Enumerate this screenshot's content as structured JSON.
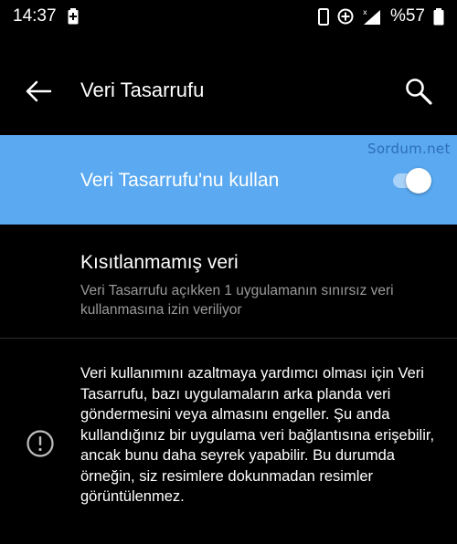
{
  "status_bar": {
    "time": "14:37",
    "battery_percent": "%57",
    "icons": [
      "battery-saver-icon",
      "phone-icon",
      "data-saver-icon",
      "signal-icon",
      "battery-icon"
    ]
  },
  "app_bar": {
    "title": "Veri Tasarrufu",
    "back_icon": "arrow-left-icon",
    "search_icon": "search-icon"
  },
  "master_switch": {
    "label": "Veri Tasarrufu'nu kullan",
    "state": "on",
    "accent_color": "#5aa9f1"
  },
  "watermark": "Sordum.net",
  "unrestricted": {
    "title": "Kısıtlanmamış veri",
    "summary": "Veri Tasarrufu açıkken 1 uygulamanın sınırsız veri kullanmasına izin veriliyor"
  },
  "info": {
    "icon": "info-icon",
    "text": "Veri kullanımını azaltmaya yardımcı olması için Veri Tasarrufu, bazı uygulamaların arka planda veri göndermesini veya almasını engeller. Şu anda kullandığınız bir uygulama veri bağlantısına erişebilir, ancak bunu daha seyrek yapabilir. Bu durumda örneğin, siz resimlere dokunmadan resimler görüntülenmez."
  }
}
